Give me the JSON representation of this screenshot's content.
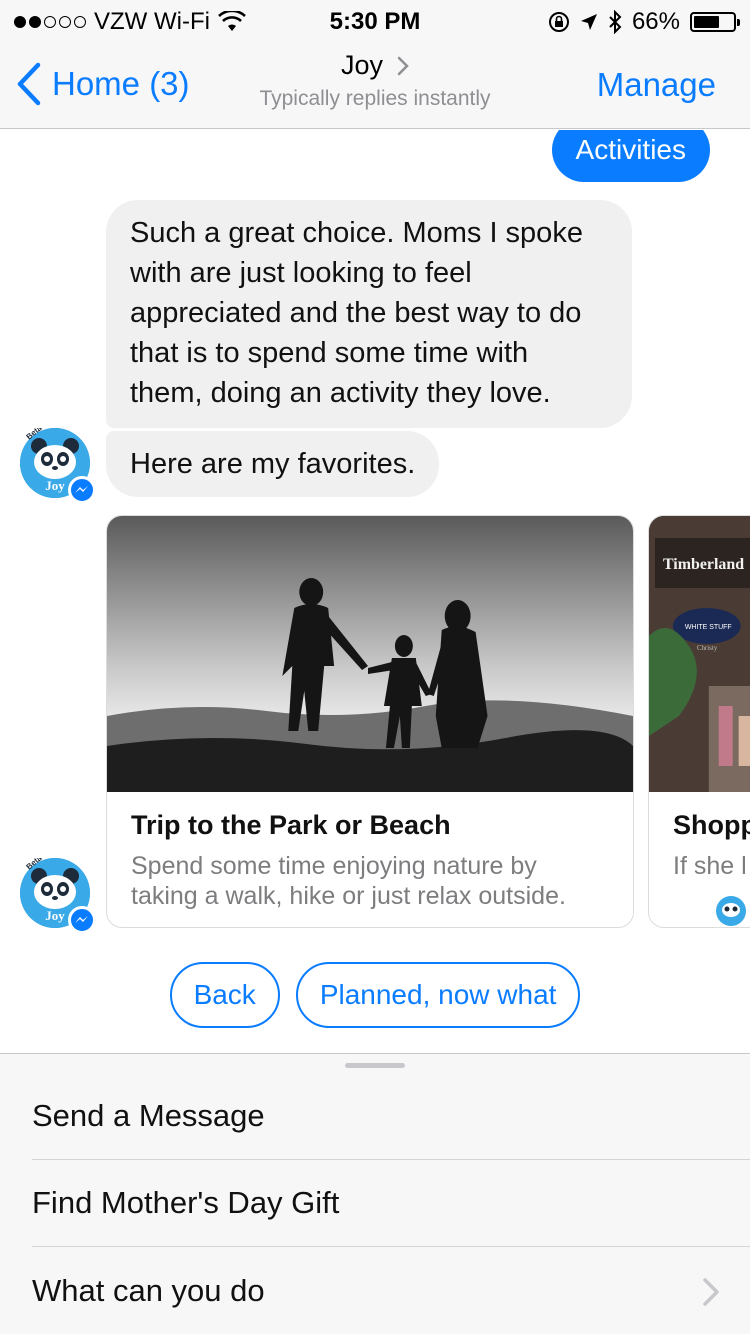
{
  "status_bar": {
    "carrier": "VZW Wi-Fi",
    "time": "5:30 PM",
    "battery": "66%",
    "battery_level": 0.66
  },
  "nav": {
    "back_label": "Home (3)",
    "title": "Joy",
    "subtitle": "Typically replies instantly",
    "manage_label": "Manage"
  },
  "chat": {
    "sent_message": "Activities",
    "received_messages": [
      "Such a great choice. Moms I spoke with are just looking to feel appreciated and the best way to do that is to spend some time with them, doing an activity they love.",
      "Here are my favorites."
    ],
    "bot_avatar_label": "Joy",
    "bot_avatar_tag": "Beta",
    "cards": [
      {
        "title": "Trip to the Park or Beach",
        "description": "Spend some time enjoying nature by taking a walk, hike or just relax outside."
      },
      {
        "title": "Shopp",
        "description": "If she l at her",
        "sign_text": "Timberland",
        "sign_text_2": "WHITE STUFF",
        "sign_text_3": "Christy"
      }
    ],
    "quick_replies": [
      "Back",
      "Planned, now what"
    ]
  },
  "menu": {
    "items": [
      "Send a Message",
      "Find Mother's Day Gift",
      "What can you do"
    ]
  },
  "colors": {
    "accent": "#0a7cff",
    "bubble_gray": "#f1f0f0",
    "bar_bg": "#f7f7f7",
    "avatar_blue": "#3aa9e8"
  }
}
